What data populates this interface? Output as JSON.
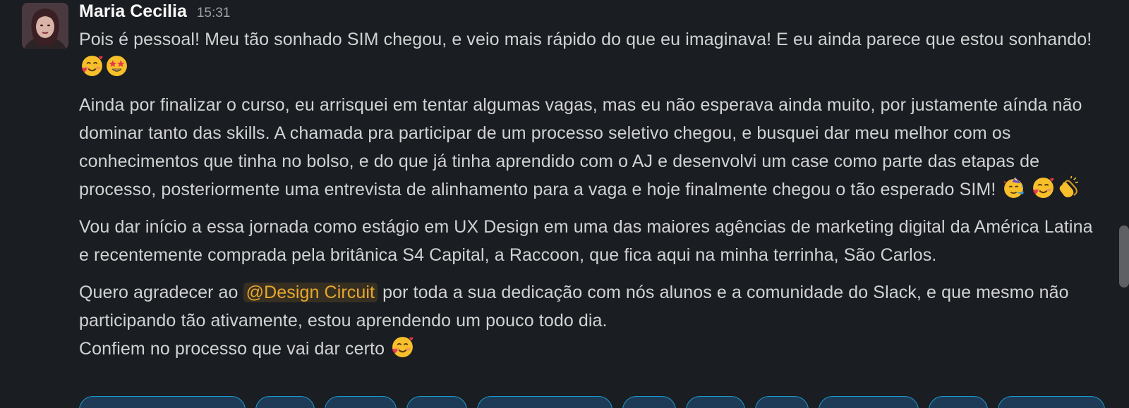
{
  "message": {
    "author": "Maria Cecilia",
    "timestamp": "15:31",
    "p1": {
      "text": "Pois é pessoal! Meu tão sonhado SIM chegou, e veio mais rápido do que eu imaginava! E eu ainda parece que estou sonhando!"
    },
    "p2": {
      "text": "Ainda por finalizar o curso, eu arrisquei em tentar algumas vagas, mas eu não esperava ainda muito, por justamente aínda não dominar tanto das skills. A chamada pra participar de um processo seletivo chegou, e busquei dar meu melhor com os conhecimentos que tinha no bolso, e do que já tinha aprendido com o AJ e desenvolvi um case como parte das etapas de processo, posteriormente uma entrevista de alinhamento para a vaga e hoje finalmente chegou o tão esperado SIM!"
    },
    "p3": {
      "text": "Vou dar início a essa jornada como estágio em UX Design em uma das maiores agências de marketing digital da América Latina e recentemente comprada pela britânica S4 Capital, a Raccoon, que fica aqui na minha terrinha, São Carlos."
    },
    "p4": {
      "before": "Quero agradecer ao",
      "mention": "@Design Circuit",
      "after": "por toda a sua dedicação com nós alunos e a comunidade do Slack, e que mesmo não participando tão ativamente, estou aprendendo um pouco todo dia."
    },
    "p5": {
      "text": "Confiem no processo que vai dar certo"
    }
  },
  "emojis": [
    "smiling-face-with-hearts",
    "star-struck",
    "partying-face",
    "clapping-hands"
  ],
  "colors": {
    "background": "#1a1d21",
    "text": "#d1d2d3",
    "author": "#f8f8f8",
    "mention": "#e8a72e",
    "reaction_border": "#1d9bd1"
  }
}
